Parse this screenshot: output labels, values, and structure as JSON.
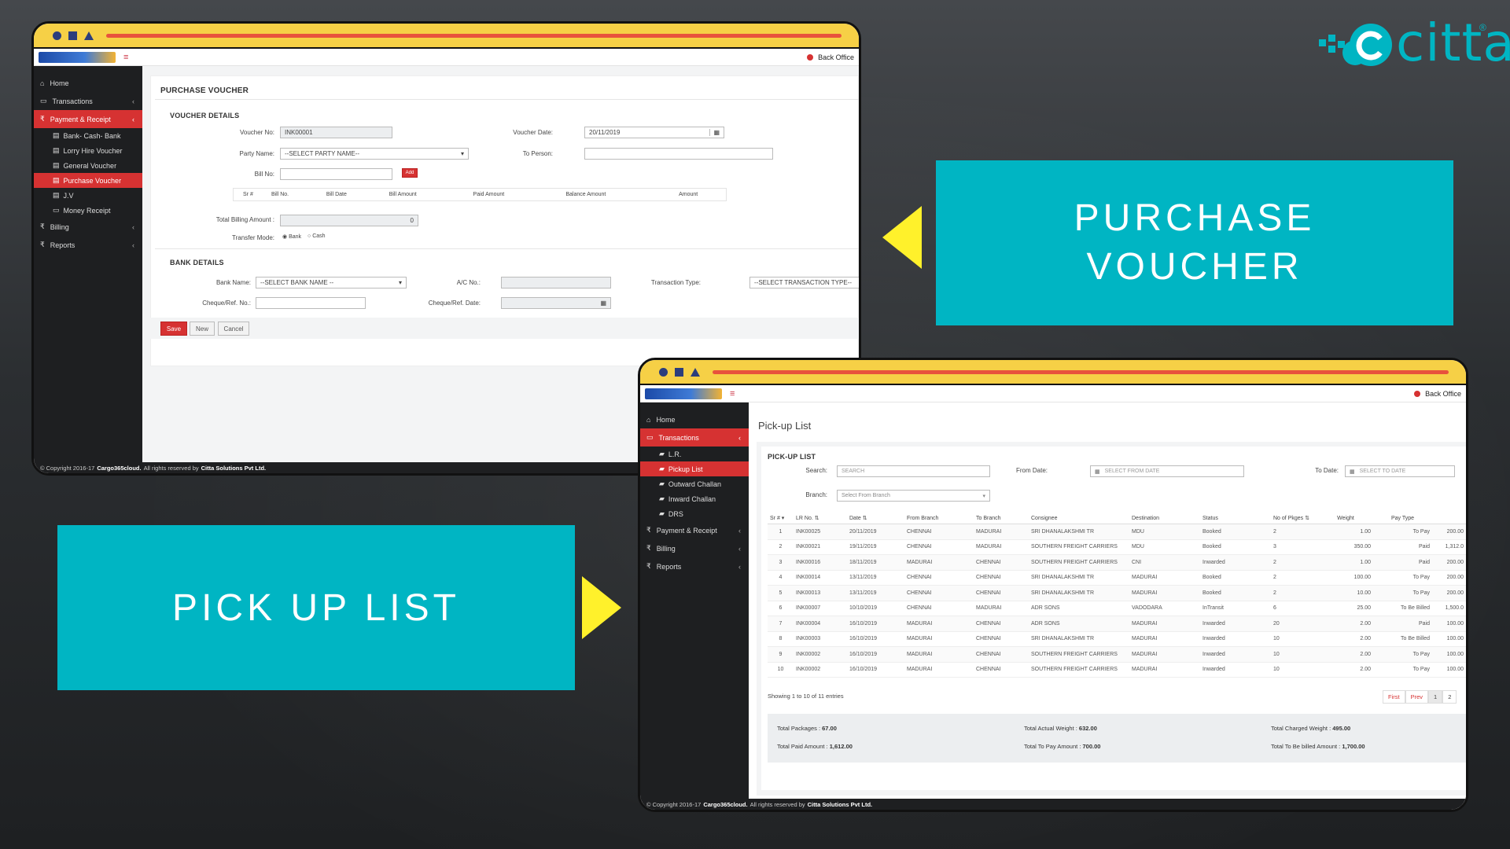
{
  "brand": {
    "name": "citta",
    "mark": "®",
    "color": "#00b5c3"
  },
  "banners": {
    "purchase": "PURCHASE VOUCHER",
    "pickup": "PICK UP LIST"
  },
  "app": {
    "back_office": "Back Office",
    "footer": {
      "prefix": "© Copyright 2016-17",
      "site": "Cargo365cloud.",
      "middle": "All rights reserved by",
      "company": "Citta Solutions Pvt Ltd."
    }
  },
  "pv": {
    "sidebar": {
      "home": "Home",
      "transactions": "Transactions",
      "payment": "Payment & Receipt",
      "subs": [
        "Bank- Cash- Bank",
        "Lorry Hire Voucher",
        "General Voucher",
        "Purchase Voucher",
        "J.V",
        "Money Receipt"
      ],
      "billing": "Billing",
      "reports": "Reports"
    },
    "title": "PURCHASE VOUCHER",
    "voucher_section": "VOUCHER DETAILS",
    "voucher_no_label": "Voucher No:",
    "voucher_no": "INK00001",
    "voucher_date_label": "Voucher Date:",
    "voucher_date": "20/11/2019",
    "party_label": "Party Name:",
    "party_value": "--SELECT PARTY NAME--",
    "to_person_label": "To Person:",
    "bill_no_label": "Bill No:",
    "add": "Add",
    "cols": [
      "Sr #",
      "Bill No.",
      "Bill Date",
      "Bill Amount",
      "Paid Amount",
      "Balance Amount",
      "Amount"
    ],
    "total_billing_label": "Total Billing Amount :",
    "total_billing": "0",
    "transfer_label": "Transfer Mode:",
    "transfer_bank": "Bank",
    "transfer_cash": "Cash",
    "bank_section": "BANK DETAILS",
    "bank_name_label": "Bank Name:",
    "bank_name": "--SELECT BANK NAME --",
    "ac_label": "A/C No.:",
    "txn_type_label": "Transaction Type:",
    "txn_type": "--SELECT TRANSACTION TYPE--",
    "cheque_no_label": "Cheque/Ref. No.:",
    "cheque_date_label": "Cheque/Ref. Date:",
    "save": "Save",
    "new": "New",
    "cancel": "Cancel"
  },
  "pl": {
    "sidebar": {
      "home": "Home",
      "transactions": "Transactions",
      "subs": [
        "L.R.",
        "Pickup List",
        "Outward Challan",
        "Inward Challan",
        "DRS"
      ],
      "payment": "Payment & Receipt",
      "billing": "Billing",
      "reports": "Reports"
    },
    "page_title": "Pick-up List",
    "section": "PICK-UP LIST",
    "search_label": "Search:",
    "search_ph": "SEARCH",
    "from_date_label": "From Date:",
    "from_date_ph": "SELECT FROM DATE",
    "to_date_label": "To Date:",
    "to_date_ph": "SELECT TO DATE",
    "branch_label": "Branch:",
    "branch_ph": "Select From Branch",
    "columns": [
      "Sr #",
      "LR No.",
      "Date",
      "From Branch",
      "To Branch",
      "Consignee",
      "Destination",
      "Status",
      "No of Pkges",
      "Weight",
      "Pay Type",
      ""
    ],
    "rows": [
      [
        "1",
        "INK00025",
        "20/11/2019",
        "CHENNAI",
        "MADURAI",
        "SRI DHANALAKSHMI TR",
        "MDU",
        "Booked",
        "2",
        "1.00",
        "To Pay",
        "200.00"
      ],
      [
        "2",
        "INK00021",
        "19/11/2019",
        "CHENNAI",
        "MADURAI",
        "SOUTHERN FREIGHT CARRIERS",
        "MDU",
        "Booked",
        "3",
        "350.00",
        "Paid",
        "1,312.0"
      ],
      [
        "3",
        "INK00016",
        "18/11/2019",
        "MADURAI",
        "CHENNAI",
        "SOUTHERN FREIGHT CARRIERS",
        "CNI",
        "Inwarded",
        "2",
        "1.00",
        "Paid",
        "200.00"
      ],
      [
        "4",
        "INK00014",
        "13/11/2019",
        "CHENNAI",
        "CHENNAI",
        "SRI DHANALAKSHMI TR",
        "MADURAI",
        "Booked",
        "2",
        "100.00",
        "To Pay",
        "200.00"
      ],
      [
        "5",
        "INK00013",
        "13/11/2019",
        "CHENNAI",
        "CHENNAI",
        "SRI DHANALAKSHMI TR",
        "MADURAI",
        "Booked",
        "2",
        "10.00",
        "To Pay",
        "200.00"
      ],
      [
        "6",
        "INK00007",
        "10/10/2019",
        "CHENNAI",
        "MADURAI",
        "ADR SONS",
        "VADODARA",
        "InTransit",
        "6",
        "25.00",
        "To Be Billed",
        "1,500.0"
      ],
      [
        "7",
        "INK00004",
        "16/10/2019",
        "MADURAI",
        "CHENNAI",
        "ADR SONS",
        "MADURAI",
        "Inwarded",
        "20",
        "2.00",
        "Paid",
        "100.00"
      ],
      [
        "8",
        "INK00003",
        "16/10/2019",
        "MADURAI",
        "CHENNAI",
        "SRI DHANALAKSHMI TR",
        "MADURAI",
        "Inwarded",
        "10",
        "2.00",
        "To Be Billed",
        "100.00"
      ],
      [
        "9",
        "INK00002",
        "16/10/2019",
        "MADURAI",
        "CHENNAI",
        "SOUTHERN FREIGHT CARRIERS",
        "MADURAI",
        "Inwarded",
        "10",
        "2.00",
        "To Pay",
        "100.00"
      ],
      [
        "10",
        "INK00002",
        "16/10/2019",
        "MADURAI",
        "CHENNAI",
        "SOUTHERN FREIGHT CARRIERS",
        "MADURAI",
        "Inwarded",
        "10",
        "2.00",
        "To Pay",
        "100.00"
      ]
    ],
    "showing": "Showing 1 to 10 of 11 entries",
    "pager": [
      "First",
      "Prev",
      "1",
      "2"
    ],
    "totals": {
      "packages_label": "Total Packages :",
      "packages": "67.00",
      "actual_weight_label": "Total Actual Weight :",
      "actual_weight": "632.00",
      "charged_weight_label": "Total Charged Weight :",
      "charged_weight": "495.00",
      "paid_label": "Total Paid Amount :",
      "paid": "1,612.00",
      "to_pay_label": "Total To Pay Amount :",
      "to_pay": "700.00",
      "to_be_billed_label": "Total To Be billed Amount :",
      "to_be_billed": "1,700.00"
    }
  }
}
